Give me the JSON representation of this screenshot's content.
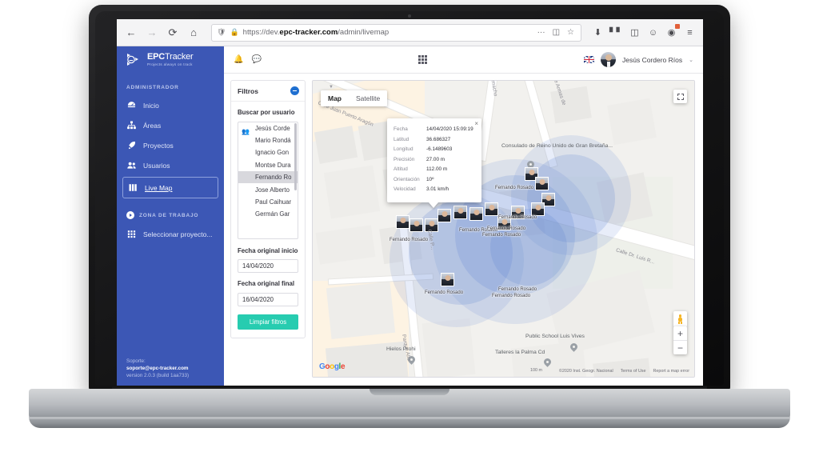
{
  "browser": {
    "back_icon": "←",
    "forward_icon": "→",
    "reload_icon": "⟳",
    "home_icon": "⌂",
    "shield_icon": "shield",
    "lock_icon": "lock",
    "url_prefix": "https://dev.",
    "url_domain": "epc-tracker.com",
    "url_path": "/admin/livemap",
    "page_actions_icon": "···",
    "reader_icon": "▭",
    "bookmark_icon": "☆",
    "download_icon": "⭳",
    "library_icon": "❙❙❙",
    "sidebar_icon": "▤",
    "account_icon": "☻",
    "extension_icon": "◕",
    "menu_icon": "≡"
  },
  "sidebar": {
    "logo_main": "EPC",
    "logo_sub": "Tracker",
    "tagline": "Projects always on track",
    "section_admin": "ADMINISTRADOR",
    "items": [
      {
        "label": "Inicio",
        "icon": "dashboard-icon"
      },
      {
        "label": "Áreas",
        "icon": "sitemap-icon"
      },
      {
        "label": "Proyectos",
        "icon": "rocket-icon"
      },
      {
        "label": "Usuarios",
        "icon": "users-icon"
      },
      {
        "label": "Live Map",
        "icon": "map-icon"
      }
    ],
    "section_zona": "ZONA DE TRABAJO",
    "project_select": "Seleccionar proyecto...",
    "support_label": "Soporte:",
    "support_email": "soporte@epc-tracker.com",
    "version": "version 2.0.3 (build 1aa733)"
  },
  "topbar": {
    "bell_icon": "🔔",
    "chat_icon": "💬",
    "apps_icon": "apps-grid-icon",
    "language": "en-GB",
    "user_name": "Jesús Cordero Ríos",
    "caret": "⌄"
  },
  "filters": {
    "title": "Filtros",
    "collapse_icon": "minus-circle-icon",
    "user_search_label": "Buscar por usuario",
    "users": [
      "Jesús Corde",
      "Mario Rondá",
      "Ignacio Gon",
      "Montse Dura",
      "Fernando Ro",
      "Jose Alberto",
      "Paul Caihuar",
      "Germán Gar"
    ],
    "selected_user_index": 4,
    "date_start_label": "Fecha original inicio",
    "date_start_value": "14/04/2020",
    "date_end_label": "Fecha original final",
    "date_end_value": "16/04/2020",
    "clear_button": "Limpiar filtros"
  },
  "map": {
    "type_map": "Map",
    "type_satellite": "Satellite",
    "selected_type": "Map",
    "fullscreen_icon": "fullscreen-icon",
    "zoom_in": "+",
    "zoom_out": "−",
    "pegman_icon": "street-view-pegman",
    "google_logo": "Google",
    "scale_label": "100 m",
    "attribution": "©2020 Inst. Geogr. Nacional",
    "terms": "Terms of Use",
    "report": "Report a map error",
    "roads": [
      "Calle Juan Puerto Aragón",
      "eos Camacho",
      "Calle Armas de",
      "Calle Dr. Luis R...",
      "Parque Alto",
      "Calle P..."
    ],
    "pois": [
      "Consulado de Reino Unido de Gran Bretaña...",
      "Public School Luis Vives",
      "Talleres la Palma Cd",
      "Hielos Prohi"
    ],
    "marker_label": "Fernando Rosado",
    "info": {
      "close_icon": "×",
      "rows": [
        {
          "key": "Fecha",
          "value": "14/04/2020 15:09:19"
        },
        {
          "key": "Latitud",
          "value": "36.686327"
        },
        {
          "key": "Longitud",
          "value": "-6.1489603"
        },
        {
          "key": "Precisión",
          "value": "27.00 m"
        },
        {
          "key": "Altitud",
          "value": "112.00 m"
        },
        {
          "key": "Orientación",
          "value": "10º"
        },
        {
          "key": "Velocidad",
          "value": "3.01 km/h"
        }
      ]
    }
  },
  "colors": {
    "brand_blue": "#3c57b5",
    "accent_teal": "#27ccb0",
    "halo_blue": "#5a82d2"
  }
}
